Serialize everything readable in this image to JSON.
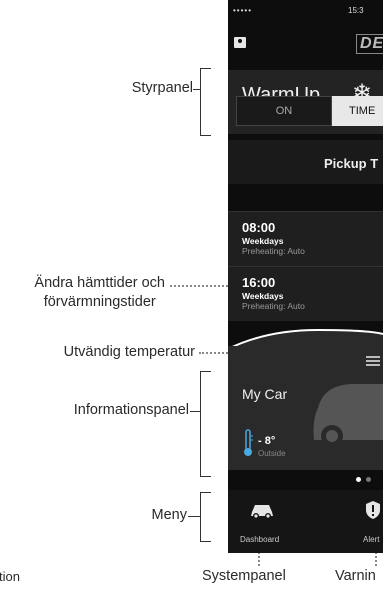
{
  "annotations": {
    "control_panel": "Styrpanel",
    "change_times_line1": "Ändra hämttider och",
    "change_times_line2": "förvärmningstider",
    "outside_temp": "Utvändig temperatur",
    "info_panel": "Informationspanel",
    "menu": "Meny",
    "system_panel": "Systempanel",
    "warnings": "Varnin",
    "cut_text": "tion"
  },
  "phone": {
    "status": {
      "signal": "•••••",
      "time": "15:3"
    },
    "logo": "DEF",
    "warmup": {
      "title": "WarmUp",
      "icon": "snowflake-icon"
    },
    "segment": {
      "on": "ON",
      "timer": "TIME"
    },
    "pickup_title": "Pickup T",
    "rows": [
      {
        "time": "08:00",
        "days": "Weekdays",
        "heating": "Preheating: Auto"
      },
      {
        "time": "16:00",
        "days": "Weekdays",
        "heating": "Preheating: Auto"
      }
    ],
    "car_name": "My Car",
    "temperature": {
      "value": "- 8°",
      "label": "Outside"
    },
    "menu": {
      "dashboard": "Dashboard",
      "alerts": "Alert"
    },
    "colors": {
      "background": "#0d0d0d",
      "panel": "#2a2a2a",
      "accent_blue": "#4aa8e0"
    }
  }
}
